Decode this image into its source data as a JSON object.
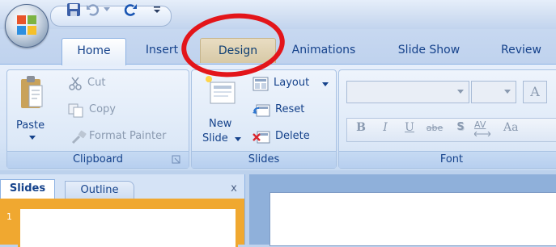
{
  "ribbon_tabs": [
    "Home",
    "Insert",
    "Design",
    "Animations",
    "Slide Show",
    "Review"
  ],
  "clipboard": {
    "paste": "Paste",
    "cut": "Cut",
    "copy": "Copy",
    "format_painter": "Format Painter",
    "group_label": "Clipboard"
  },
  "slides": {
    "new_slide_line1": "New",
    "new_slide_line2": "Slide",
    "layout": "Layout",
    "reset": "Reset",
    "delete": "Delete",
    "group_label": "Slides"
  },
  "font": {
    "group_label": "Font",
    "bold": "B",
    "italic": "I",
    "underline": "U",
    "strikethrough": "abe",
    "shadow": "S",
    "spacing": "AV",
    "change_case": "Aa",
    "grow_font": "A"
  },
  "panel": {
    "tab_slides": "Slides",
    "tab_outline": "Outline",
    "close": "x",
    "slide_number": "1"
  },
  "colors": {
    "highlight": "#e3151a",
    "accent": "#15428b",
    "selected_slide_border": "#f0a830"
  }
}
